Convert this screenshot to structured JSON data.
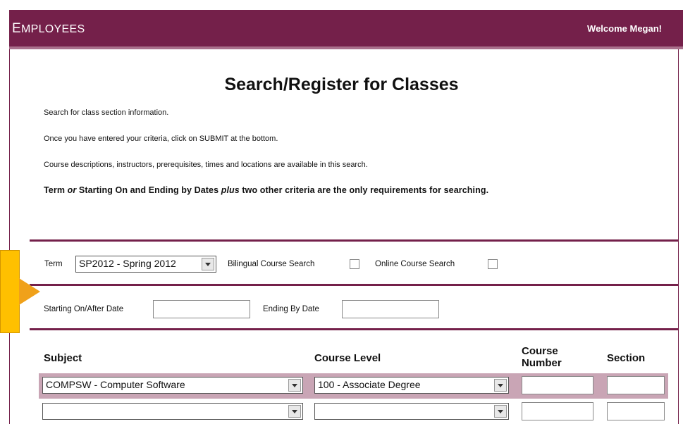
{
  "header": {
    "brand_first": "E",
    "brand_rest": "MPLOYEES",
    "welcome": "Welcome Megan!"
  },
  "page": {
    "title": "Search/Register for Classes",
    "info1": "Search for class section information.",
    "info2": "Once you have entered your criteria, click on SUBMIT at the bottom.",
    "info3": "Course descriptions, instructors, prerequisites, times and locations are available in this search.",
    "req_a": "Term ",
    "req_or": "or",
    "req_b": " Starting On and Ending by Dates ",
    "req_plus": "plus",
    "req_c": " two other criteria are the only requirements for searching."
  },
  "filters": {
    "term_label": "Term",
    "term_value": "SP2012 - Spring 2012",
    "bilingual_label": "Bilingual Course Search",
    "online_label": "Online Course Search",
    "start_label": "Starting On/After Date",
    "end_label": "Ending By Date"
  },
  "table": {
    "col_subject": "Subject",
    "col_level": "Course Level",
    "col_number_1": "Course",
    "col_number_2": "Number",
    "col_section": "Section",
    "rows": [
      {
        "subject": "COMPSW - Computer Software",
        "level": "100 - Associate Degree"
      },
      {
        "subject": "",
        "level": ""
      }
    ]
  },
  "colors": {
    "accent": "#74204a",
    "callout": "#ffc000"
  }
}
